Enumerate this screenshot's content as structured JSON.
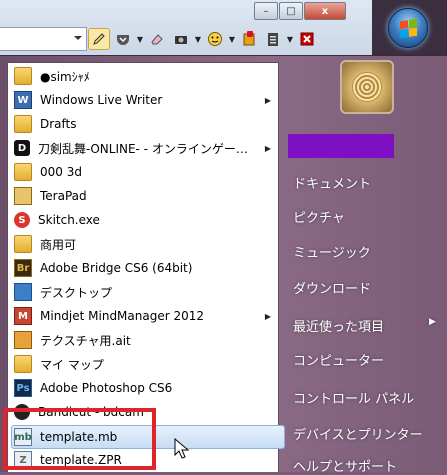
{
  "window_controls": {
    "minimize": "–",
    "maximize": "□",
    "close": "x"
  },
  "start_menu": {
    "programs": [
      {
        "label": "●simｼｬﾒ",
        "icon": "folder-icon",
        "submenu": false
      },
      {
        "label": "Windows Live Writer",
        "icon": "writer-icon",
        "submenu": true
      },
      {
        "label": "Drafts",
        "icon": "folder-icon",
        "submenu": false
      },
      {
        "label": "刀剣乱舞-ONLINE- - オンラインゲー…",
        "icon": "dmm-icon",
        "submenu": true
      },
      {
        "label": "000 3d",
        "icon": "folder-icon",
        "submenu": false
      },
      {
        "label": "TeraPad",
        "icon": "terapad-icon",
        "submenu": false
      },
      {
        "label": "Skitch.exe",
        "icon": "skitch-icon",
        "submenu": false
      },
      {
        "label": "商用可",
        "icon": "folder-icon",
        "submenu": false
      },
      {
        "label": "Adobe Bridge CS6 (64bit)",
        "icon": "bridge-icon",
        "submenu": false
      },
      {
        "label": "デスクトップ",
        "icon": "desktop-icon",
        "submenu": false
      },
      {
        "label": "Mindjet MindManager 2012",
        "icon": "mindjet-icon",
        "submenu": true
      },
      {
        "label": "テクスチャ用.ait",
        "icon": "ait-file-icon",
        "submenu": false
      },
      {
        "label": "マイ マップ",
        "icon": "folder-icon",
        "submenu": false
      },
      {
        "label": "Adobe Photoshop CS6",
        "icon": "photoshop-icon",
        "submenu": false
      },
      {
        "label": "Bandicut - bdcam",
        "icon": "bandicut-icon",
        "submenu": false
      },
      {
        "label": "template.mb",
        "icon": "maya-file-icon",
        "submenu": false
      },
      {
        "label": "template.ZPR",
        "icon": "zbrush-file-icon",
        "submenu": false
      }
    ],
    "right_items": [
      {
        "label": "ドキュメント",
        "submenu": false
      },
      {
        "label": "ピクチャ",
        "submenu": false
      },
      {
        "label": "ミュージック",
        "submenu": false
      },
      {
        "label": "ダウンロード",
        "submenu": false
      },
      {
        "label": "最近使った項目",
        "submenu": true
      },
      {
        "label": "コンピューター",
        "submenu": false
      },
      {
        "label": "コントロール パネル",
        "submenu": false
      },
      {
        "label": "デバイスとプリンター",
        "submenu": false
      },
      {
        "label": "ヘルプとサポート",
        "submenu": false
      }
    ],
    "submenu_arrow": "▶"
  },
  "colors": {
    "highlight_box": "#e0242b",
    "user_name_block": "#7d10c2"
  }
}
